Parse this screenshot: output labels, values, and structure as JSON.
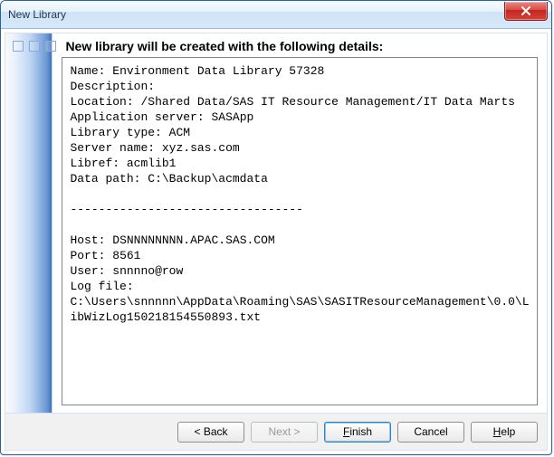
{
  "window": {
    "title": "New Library"
  },
  "heading": "New library will be created with the following details:",
  "details": {
    "name_label": "Name:",
    "name_value": "Environment Data Library 57328",
    "description_label": "Description:",
    "description_value": "",
    "location_label": "Location:",
    "location_value": "/Shared Data/SAS IT Resource Management/IT Data Marts",
    "appserver_label": "Application server:",
    "appserver_value": "SASApp",
    "libtype_label": "Library type:",
    "libtype_value": "ACM",
    "servername_label": "Server name:",
    "servername_value": "xyz.sas.com",
    "libref_label": "Libref:",
    "libref_value": "acmlib1",
    "datapath_label": "Data path:",
    "datapath_value": "C:\\Backup\\acmdata",
    "separator": "---------------------------------",
    "host_label": "Host:",
    "host_value": "DSNNNNNNNN.APAC.SAS.COM",
    "port_label": "Port:",
    "port_value": "8561",
    "user_label": "User:",
    "user_value": "snnnno@row",
    "logfile_label": "Log file:",
    "logfile_value": "C:\\Users\\snnnnn\\AppData\\Roaming\\SAS\\SASITResourceManagement\\0.0\\LibWizLog150218154550893.txt"
  },
  "buttons": {
    "back": "< Back",
    "next": "Next >",
    "finish": "Finish",
    "cancel": "Cancel",
    "help": "Help"
  }
}
